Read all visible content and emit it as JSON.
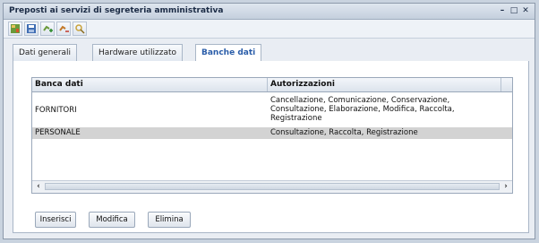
{
  "window": {
    "title": "Preposti ai servizi di segreteria amministrativa",
    "controls": [
      "–",
      "□",
      "✕"
    ]
  },
  "toolbar": {
    "icons": [
      "list-icon",
      "save-icon",
      "add-icon",
      "remove-icon",
      "search-icon"
    ]
  },
  "tabs": [
    {
      "label": "Dati generali",
      "active": false
    },
    {
      "label": "Hardware utilizzato",
      "active": false
    },
    {
      "label": "Banche dati",
      "active": true
    }
  ],
  "grid": {
    "columns": [
      "Banca dati",
      "Autorizzazioni"
    ],
    "rows": [
      {
        "banca": "FORNITORI",
        "autorizzazioni": "Cancellazione, Comunicazione, Conservazione, Consultazione, Elaborazione, Modifica, Raccolta, Registrazione",
        "selected": false
      },
      {
        "banca": "PERSONALE",
        "autorizzazioni": "Consultazione, Raccolta, Registrazione",
        "selected": true
      }
    ]
  },
  "buttons": {
    "insert": "Inserisci",
    "edit": "Modifica",
    "delete": "Elimina"
  }
}
